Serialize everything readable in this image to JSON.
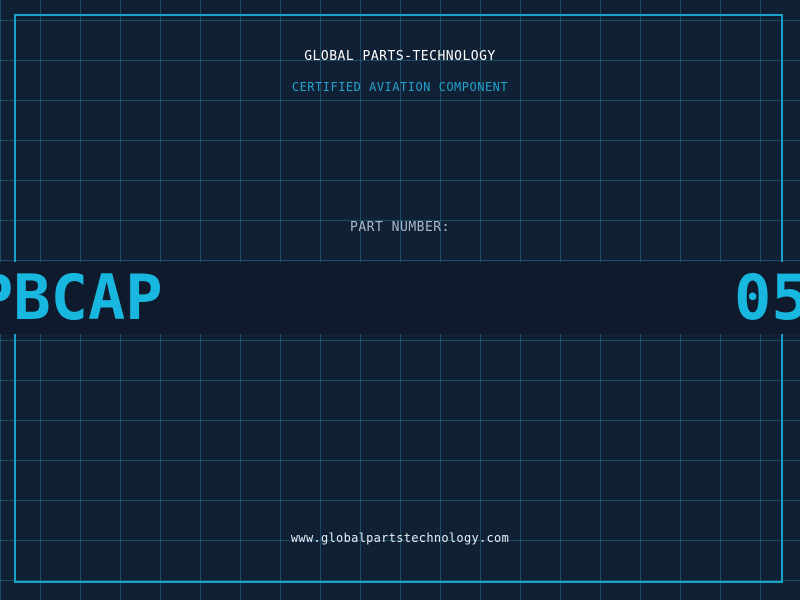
{
  "header": {
    "brand": "GLOBAL PARTS-TECHNOLOGY",
    "subtitle": "CERTIFIED AVIATION COMPONENT"
  },
  "part": {
    "label": "PART NUMBER:",
    "code_left_visible": "PBCAP",
    "code_right_visible": "05"
  },
  "footer": {
    "website": "www.globalpartstechnology.com"
  },
  "colors": {
    "background": "#102035",
    "grid": "#286e8c",
    "accent": "#18b7df",
    "band": "#0f1a2c",
    "frame": "#1aa3c8",
    "label_text": "#a9b9c8",
    "primary_text": "#ffffff"
  }
}
